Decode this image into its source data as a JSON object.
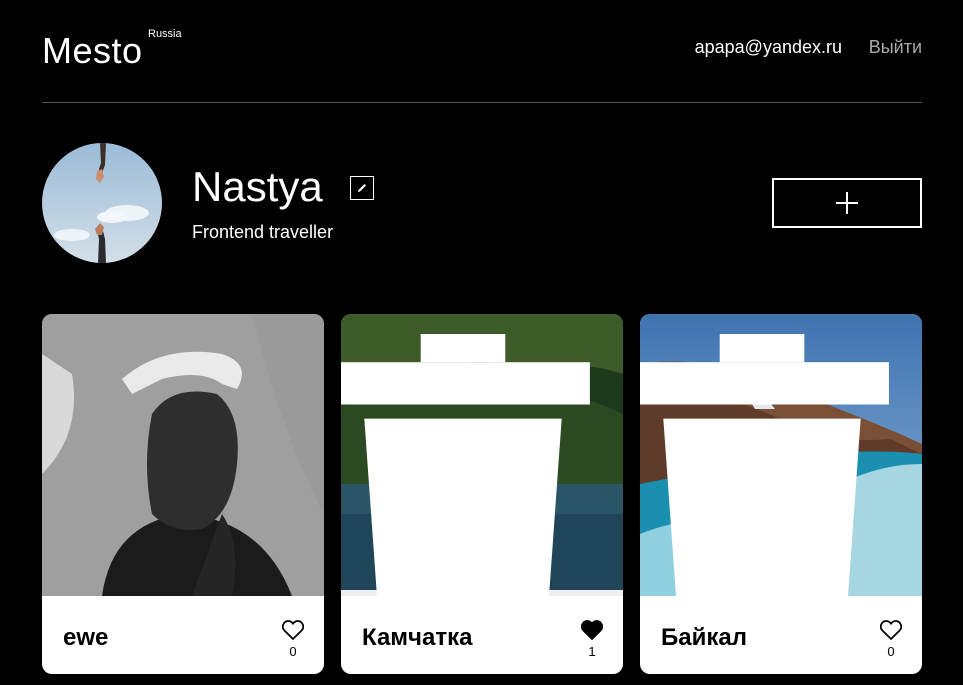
{
  "header": {
    "logo": "Mesto",
    "logo_sup": "Russia",
    "email": "apapa@yandex.ru",
    "logout": "Выйти"
  },
  "profile": {
    "name": "Nastya",
    "about": "Frontend traveller"
  },
  "cards": [
    {
      "title": "ewe",
      "likes": "0",
      "liked": false,
      "deletable": false
    },
    {
      "title": "Камчатка",
      "likes": "1",
      "liked": true,
      "deletable": true
    },
    {
      "title": "Байкал",
      "likes": "0",
      "liked": false,
      "deletable": true
    }
  ],
  "colors": {
    "background": "#000000",
    "card": "#ffffff",
    "divider": "#545454",
    "muted": "#a9a9a9"
  },
  "icons": {
    "edit": "pencil-icon",
    "add": "plus-icon",
    "delete": "trash-icon",
    "like": "heart-icon"
  }
}
